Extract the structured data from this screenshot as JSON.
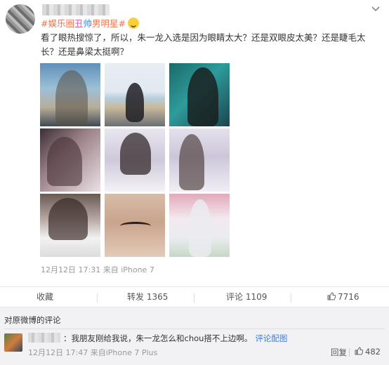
{
  "post": {
    "topic_prefix": "#",
    "topic_part1": "娱乐圈",
    "topic_part2": "丑",
    "topic_part3": "帅",
    "topic_part4": "男明星",
    "topic_suffix": "#",
    "text": "看了眼热搜惊了，所以，朱一龙入选是因为眼睛太大？还是双眼皮太美？还是睫毛太长？还是鼻梁太挺啊？",
    "timestamp": "12月12日 17:31",
    "source": "来自 iPhone 7",
    "photos": [
      "photo-1",
      "photo-2",
      "photo-3",
      "photo-4",
      "photo-5",
      "photo-6",
      "photo-7",
      "photo-8",
      "photo-9"
    ]
  },
  "actions": {
    "favorite": "收藏",
    "repost_label": "转发",
    "repost_count": "1365",
    "comment_label": "评论",
    "comment_count": "1109",
    "like_count": "7716"
  },
  "comments": {
    "header": "对原微博的评论",
    "items": [
      {
        "text": "：我朋友刚给我说，朱一龙怎么和chou搭不上边啊。",
        "link": "评论配图",
        "timestamp": "12月12日 17:47",
        "source": "来自iPhone 7 Plus",
        "reply_label": "回复",
        "like_count": "482"
      }
    ]
  },
  "icons": {
    "chevron": "chevron-down-icon",
    "like": "thumbs-up-icon",
    "emoji": "sweat-smile-emoji-icon"
  },
  "colors": {
    "topic_orange": "#eb7350",
    "topic_pink": "#e64ea0",
    "topic_blue": "#3f7de2",
    "link_blue": "#3f7de2"
  }
}
